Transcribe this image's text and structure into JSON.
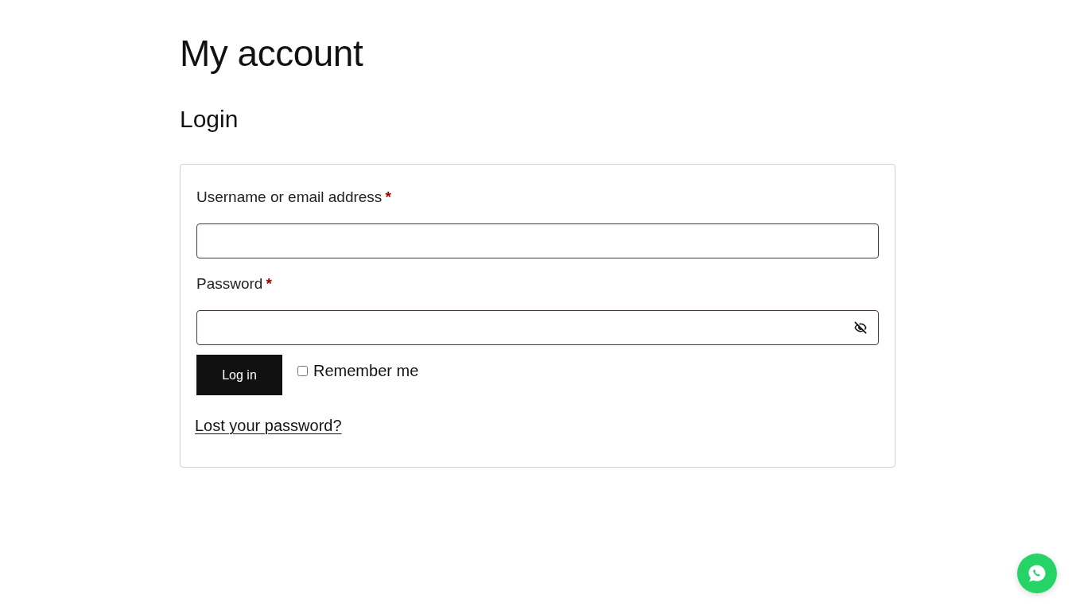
{
  "page_title": "My account",
  "login": {
    "heading": "Login",
    "fields": [
      {
        "kind": "text",
        "label": "Username or email address",
        "required_mark": "*"
      },
      {
        "kind": "password",
        "label": "Password",
        "required_mark": "*"
      }
    ],
    "submit_button": "Log in",
    "remember_me": {
      "label": "Remember me",
      "checked": false
    },
    "lost_password_link": "Lost your password?"
  }
}
